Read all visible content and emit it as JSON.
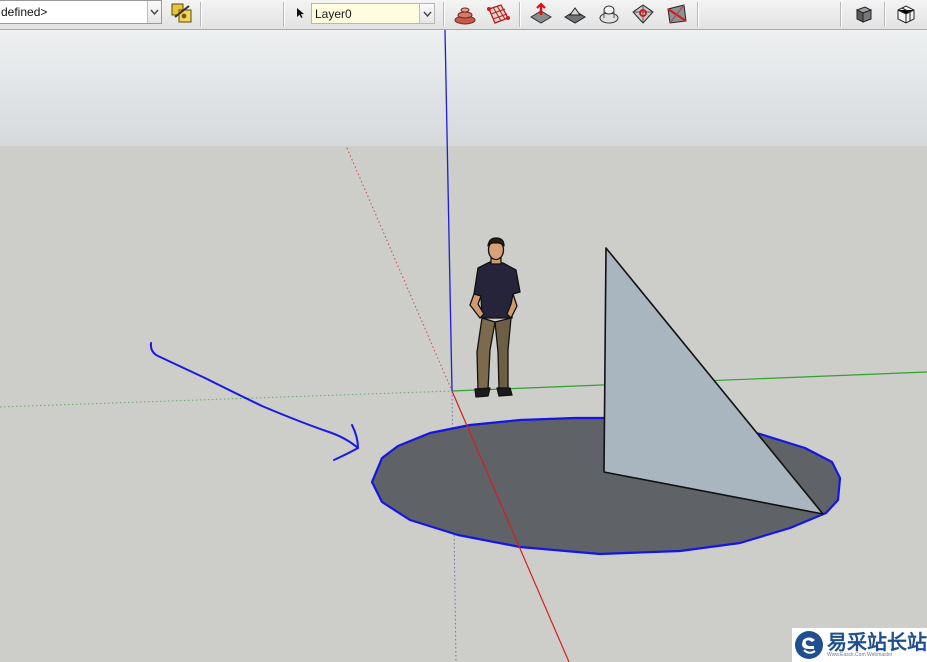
{
  "toolbar": {
    "style_value": "defined>",
    "layer_value": "Layer0"
  },
  "toolbar_icons": [
    "style-settings-icon",
    "layer-pointer-icon",
    "sandbox-from-contours-icon",
    "sandbox-from-scratch-icon",
    "smoove-icon",
    "stamp-icon",
    "drape-icon",
    "add-detail-icon",
    "flip-edge-icon",
    "outliner-icon",
    "components-icon"
  ],
  "colors": {
    "blue_axis": "#1d1dd6",
    "red_axis": "#d32020",
    "green_axis": "#2fa22f",
    "circle_fill": "#5f6368",
    "circle_edge": "#1515e6",
    "triangle_fill": "#a9b6c0",
    "annotation": "#1a1ae0"
  },
  "watermark": {
    "cn": "易采站长站",
    "en": "Www.Easck.Com  Webmaster"
  }
}
